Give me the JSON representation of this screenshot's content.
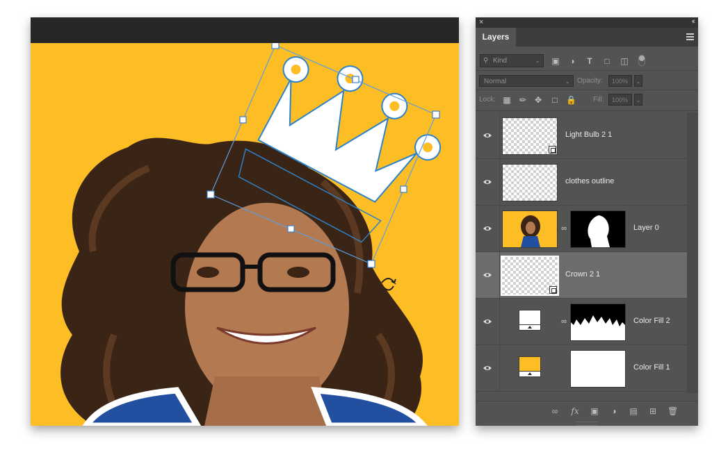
{
  "panel": {
    "title": "Layers",
    "close_glyph": "×",
    "collapse_glyph": "‹‹",
    "filter": {
      "kind_label": "Kind",
      "icons": [
        "image-filter-icon",
        "adjustment-filter-icon",
        "type-filter-icon",
        "shape-filter-icon",
        "smart-object-filter-icon"
      ]
    },
    "blend_mode": "Normal",
    "opacity_label": "Opacity:",
    "opacity_value": "100%",
    "lock_label": "Lock:",
    "fill_label": "Fill:",
    "fill_value": "100%"
  },
  "layers": [
    {
      "name": "Light Bulb 2 1",
      "thumb": "transparent",
      "smart": true,
      "mask": null,
      "selected": false
    },
    {
      "name": "clothes outline",
      "thumb": "transparent",
      "smart": false,
      "mask": null,
      "selected": false
    },
    {
      "name": "Layer 0",
      "thumb": "photo",
      "smart": false,
      "mask": "black-silhouette",
      "selected": false
    },
    {
      "name": "Crown 2 1",
      "thumb": "transparent",
      "smart": true,
      "mask": null,
      "selected": true
    },
    {
      "name": "Color Fill 2",
      "thumb": "fill-white",
      "smart": false,
      "mask": "black-hair-edge",
      "selected": false
    },
    {
      "name": "Color Fill 1",
      "thumb": "fill-yellow",
      "smart": false,
      "mask": "white",
      "selected": false
    }
  ],
  "colors": {
    "canvas_background": "#fdbd25",
    "panel_background": "#535353",
    "selected_layer": "#6c6c6c",
    "transform_handles": "#5a9ee0"
  }
}
